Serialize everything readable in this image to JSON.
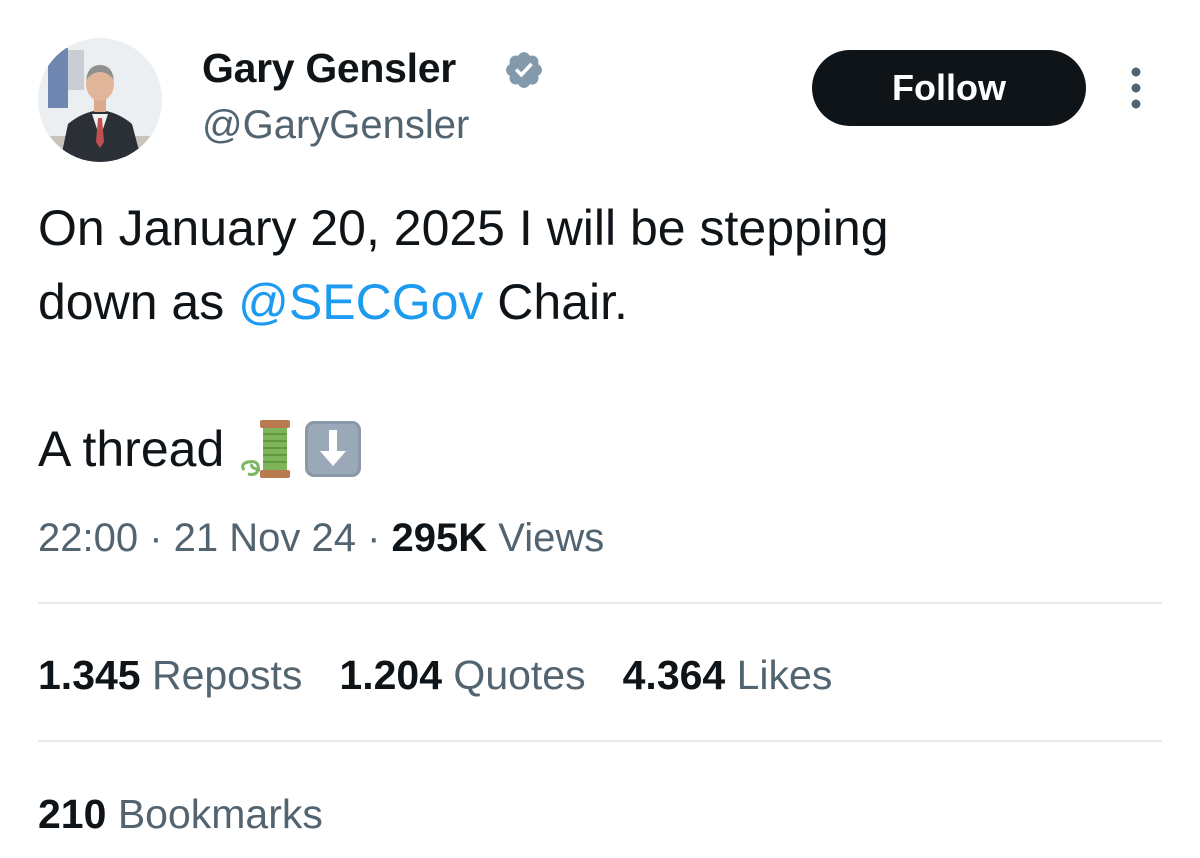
{
  "author": {
    "display_name": "Gary Gensler",
    "handle": "@GaryGensler",
    "verified": true,
    "avatar_icon": "profile-photo-icon"
  },
  "header": {
    "follow_label": "Follow",
    "more_icon": "more-options-icon"
  },
  "tweet": {
    "line1": "On January 20, 2025 I will be stepping",
    "line2_prefix": "down as ",
    "mention": "@SECGov",
    "line2_suffix": " Chair.",
    "line3": "A thread",
    "emojis": [
      "thread-spool-icon",
      "down-arrow-icon"
    ]
  },
  "meta": {
    "time": "22:00",
    "sep1": " · ",
    "date": "21 Nov 24",
    "sep2": " · ",
    "views_count": "295K",
    "views_label": " Views"
  },
  "stats": [
    {
      "count": "1.345",
      "label": " Reposts"
    },
    {
      "count": "1.204",
      "label": " Quotes"
    },
    {
      "count": "4.364",
      "label": " Likes"
    }
  ],
  "bookmarks": {
    "count": "210",
    "label": " Bookmarks"
  },
  "colors": {
    "text": "#0f1419",
    "secondary": "#536471",
    "link": "#1d9bf0",
    "verified_badge": "#829aab",
    "divider": "#e7e9ea"
  }
}
